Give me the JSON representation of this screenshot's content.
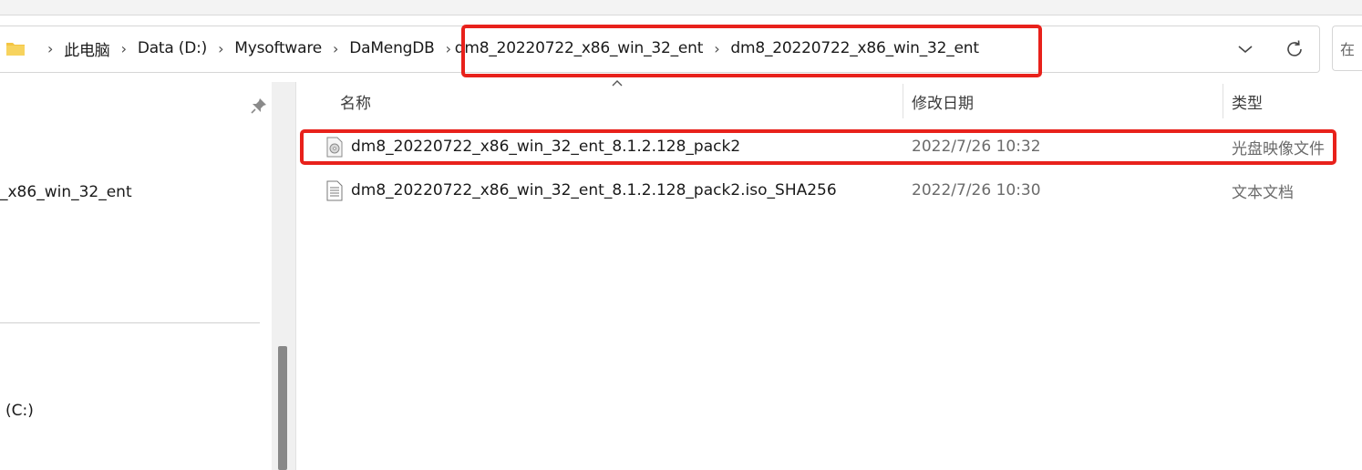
{
  "address": {
    "crumbs": [
      "此电脑",
      "Data (D:)",
      "Mysoftware",
      "DaMengDB",
      "dm8_20220722_x86_win_32_ent",
      "dm8_20220722_x86_win_32_ent"
    ],
    "search_placeholder": "在"
  },
  "sidebar": {
    "items": [
      {
        "label": "_x86_win_32_ent"
      },
      {
        "label": "(C:)"
      }
    ]
  },
  "columns": {
    "name": "名称",
    "date": "修改日期",
    "type": "类型"
  },
  "files": [
    {
      "name": "dm8_20220722_x86_win_32_ent_8.1.2.128_pack2",
      "date": "2022/7/26 10:32",
      "type": "光盘映像文件",
      "icon": "disc-image-icon"
    },
    {
      "name": "dm8_20220722_x86_win_32_ent_8.1.2.128_pack2.iso_SHA256",
      "date": "2022/7/26 10:30",
      "type": "文本文档",
      "icon": "text-document-icon"
    }
  ],
  "colors": {
    "highlight": "#e8211b",
    "folder": "#f4c542"
  }
}
